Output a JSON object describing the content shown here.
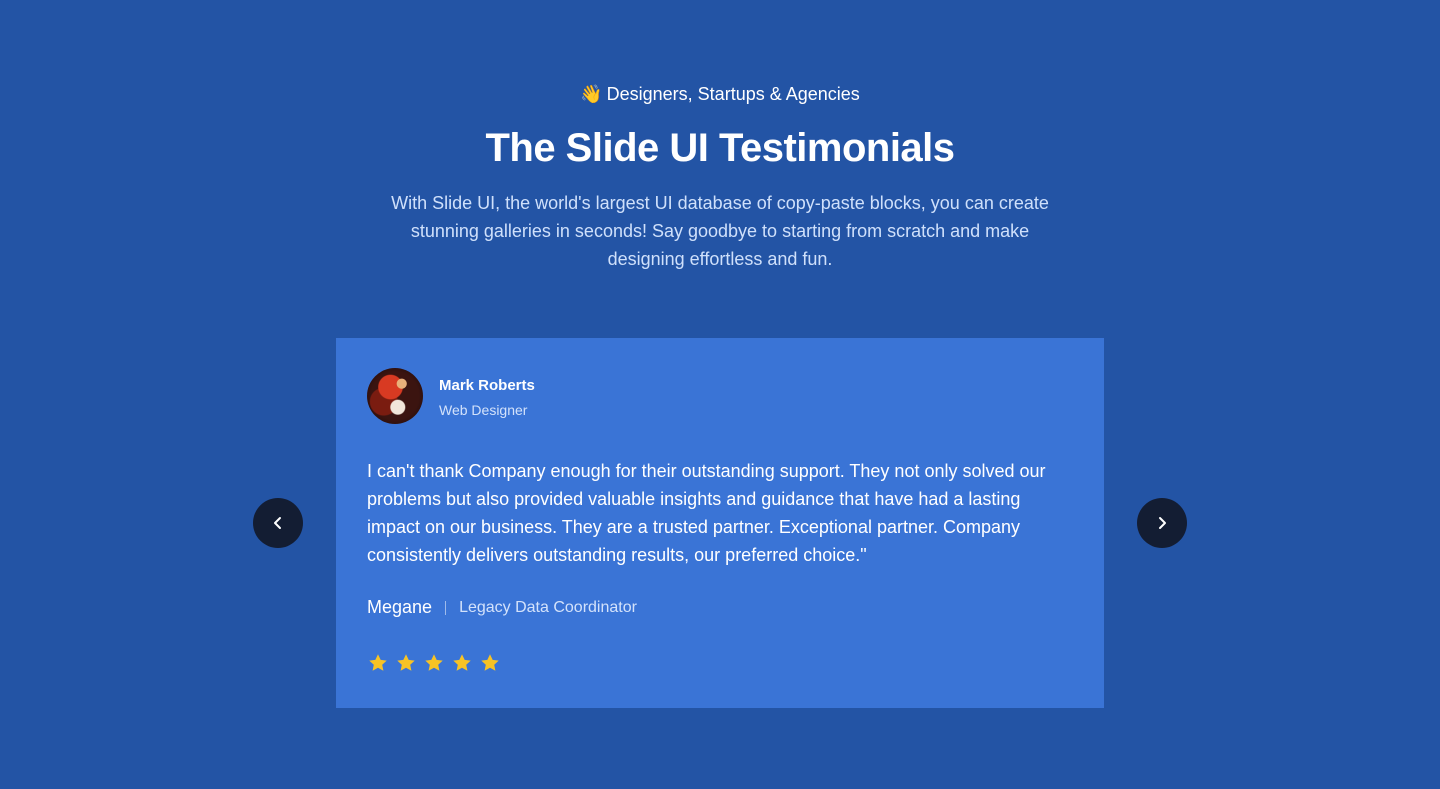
{
  "header": {
    "eyebrow_icon": "waving-hand-icon",
    "eyebrow_emoji": "👋",
    "eyebrow_text": "Designers, Startups & Agencies",
    "title": "The Slide UI Testimonials",
    "subtitle": "With Slide UI, the world's largest UI database of copy-paste blocks, you can create stunning galleries in seconds! Say goodbye to starting from scratch and make designing effortless and fun."
  },
  "testimonial": {
    "person_name": "Mark Roberts",
    "person_role": "Web Designer",
    "quote": "I can't thank Company enough for their outstanding support. They not only solved our problems but also provided valuable insights and guidance that have had a lasting impact on our business. They are a trusted partner. Exceptional partner. Company consistently delivers outstanding results, our preferred choice.\"",
    "author_name": "Megane",
    "author_title": "Legacy Data Coordinator",
    "rating": 5,
    "rating_max": 5
  },
  "navigation": {
    "prev_icon": "chevron-left-icon",
    "next_icon": "chevron-right-icon"
  },
  "colors": {
    "background": "#2354a5",
    "card": "#3a74d6",
    "nav_button": "#131d33",
    "star": "#f7c325",
    "subtitle_text": "#cfe0fb"
  }
}
